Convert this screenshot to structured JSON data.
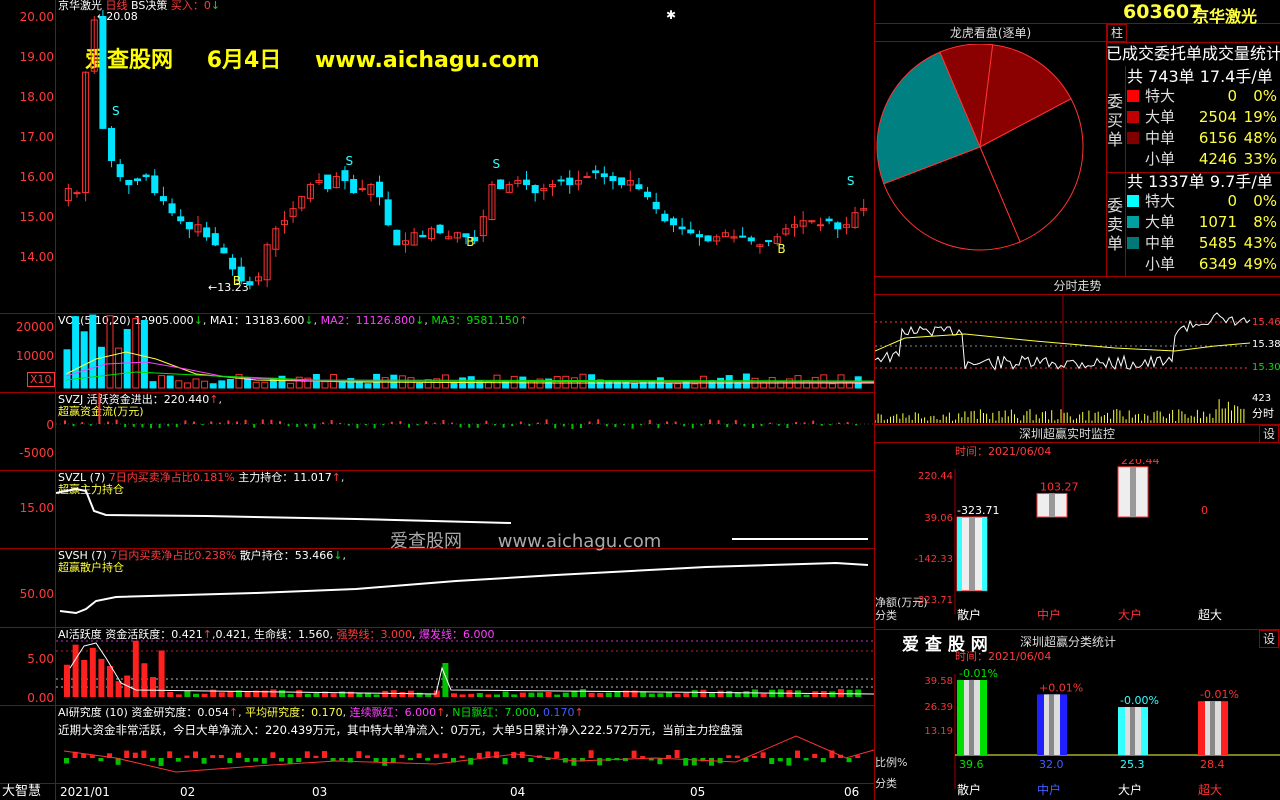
{
  "app": {
    "name": "大智慧"
  },
  "main": {
    "chart_label": "京华激光",
    "period": "日线",
    "strategy": "BS决策",
    "buy_label": "买入：",
    "buy_value": "0",
    "watermark_title": "爱查股网",
    "watermark_date": "6月4日",
    "watermark_url": "www.aichagu.com",
    "high_label": "20.08",
    "low_label": "13.23",
    "price_axis": [
      "20.00",
      "19.00",
      "18.00",
      "17.00",
      "16.00",
      "15.00",
      "14.00"
    ],
    "signals": {
      "buy": "B",
      "sell": "S"
    }
  },
  "chart_data": [
    {
      "type": "candlestick",
      "title": "京华激光 日线",
      "ylim": [
        13.0,
        20.2
      ],
      "high": 20.08,
      "low": 13.23,
      "ohlc_closes": [
        15.8,
        15.7,
        18.7,
        20.0,
        17.3,
        16.5,
        16.1,
        15.9,
        16.0,
        16.1,
        15.7,
        15.5,
        15.2,
        15.0,
        14.8,
        14.9,
        14.6,
        14.4,
        14.2,
        13.8,
        13.5,
        13.4,
        13.6,
        14.4,
        14.8,
        15.0,
        15.3,
        15.6,
        15.9,
        16.0,
        15.8,
        16.1,
        16.0,
        15.7,
        15.8,
        15.9,
        15.6,
        14.9,
        14.4,
        14.5,
        14.7,
        14.6,
        14.8,
        14.7,
        14.6,
        14.7,
        14.6,
        14.5,
        15.1,
        15.9,
        15.8,
        15.9,
        16.0,
        15.9,
        15.7,
        15.8,
        15.9,
        16.0,
        15.9,
        16.0,
        16.1,
        16.2,
        16.1,
        16.0,
        15.9,
        16.0,
        15.8,
        15.6,
        15.3,
        15.0,
        14.9,
        14.8,
        14.7,
        14.6,
        14.5,
        14.6,
        14.7,
        14.6,
        14.6,
        14.5,
        14.4,
        14.5,
        14.6,
        14.8,
        14.9,
        15.0,
        15.0,
        14.9,
        15.0,
        14.8,
        14.9,
        15.2,
        15.3
      ],
      "sell_signals": 4,
      "buy_signals": 4
    },
    {
      "type": "bar",
      "title": "VOL(5,10,20)",
      "values_label": "12905.000",
      "ma1_label": "MA1：",
      "ma1": "13183.600",
      "ma2_label": "MA2：",
      "ma2": "11126.800",
      "ma3_label": "MA3：",
      "ma3": "9581.150",
      "ticks": [
        "20000",
        "10000"
      ],
      "unit": "X10"
    },
    {
      "type": "bar",
      "title": "SVZJ",
      "line1": "活跃资金进出：",
      "v1": "220.440",
      "line2": "超赢资金流(万元)",
      "ticks": [
        "0",
        "-5000"
      ]
    },
    {
      "type": "line",
      "title": "SVZL (7)",
      "t1": "7日内买卖净占比",
      "v1": "0.181%",
      "t2": "主力持仓：",
      "v2": "11.017",
      "sub": "超赢主力持仓",
      "ticks": [
        "15.00"
      ]
    },
    {
      "type": "line",
      "title": "SVSH (7)",
      "t1": "7日内买卖净占比",
      "v1": "0.238%",
      "t2": "散户持仓：",
      "v2": "53.466",
      "sub": "超赢散户持仓",
      "ticks": [
        "50.00"
      ]
    },
    {
      "type": "bar",
      "title": "AI活跃度",
      "t1": "资金活跃度：",
      "v1": "0.421",
      "v1b": "0.421",
      "t2": "生命线：",
      "v2": "1.560",
      "t3": "强势线：",
      "v3": "3.000",
      "t4": "爆发线：",
      "v4": "6.000",
      "ticks": [
        "5.00",
        "0.00"
      ]
    },
    {
      "type": "bar",
      "title": "AI研究度 (10)",
      "t1": "资金研究度：",
      "v1": "0.054",
      "t2": "平均研究度：",
      "v2": "0.170",
      "t3": "连续飘红：",
      "v3": "6.000",
      "t4": "N日飘红：",
      "v4": "7.000",
      "v5": "0.170",
      "summary": "近期大资金非常活跃，今日大单净流入：220.439万元，其中特大单净流入：0万元，大单5日累计净入222.572万元，当前主力控盘强"
    },
    {
      "type": "pie",
      "title": "龙虎看盘(逐单)",
      "slices": [
        {
          "name": "特大(买)",
          "value": 0
        },
        {
          "name": "大单(买)",
          "value": 19
        },
        {
          "name": "中单(买)",
          "value": 48
        },
        {
          "name": "小单(买)",
          "value": 33
        }
      ]
    },
    {
      "type": "line",
      "title": "分时走势",
      "ticks": [
        "15.46",
        "15.38",
        "15.30",
        "423"
      ],
      "vol_label": "分时"
    },
    {
      "type": "bar",
      "title": "深圳超赢实时监控",
      "date_label": "时间：",
      "date": "2021/06/04",
      "categories": [
        "散户",
        "中户",
        "大户",
        "超大"
      ],
      "values": [
        -323.71,
        103.27,
        220.44,
        0
      ],
      "ylabels": [
        "220.44",
        "39.06",
        "-142.33",
        "-323.71"
      ],
      "ylabel": "净额(万元)",
      "xlabel": "分类"
    },
    {
      "type": "bar",
      "title": "深圳超赢分类统计",
      "date_label": "时间：",
      "date": "2021/06/04",
      "categories": [
        "散户",
        "中户",
        "大户",
        "超大"
      ],
      "values": [
        39.6,
        32.0,
        25.3,
        28.4
      ],
      "changes": [
        "-0.01%",
        "+0.01%",
        "-0.00%",
        "-0.01%"
      ],
      "ylabels": [
        "39.58",
        "26.39",
        "13.19"
      ],
      "ylabel": "比例%",
      "xlabel": "分类"
    }
  ],
  "time_axis": [
    "2021/01",
    "02",
    "03",
    "04",
    "05",
    "06"
  ],
  "right": {
    "code": "603607",
    "name": "京华激光",
    "btn_zhu": "柱",
    "pie_title": "龙虎看盘(逐单)",
    "stat_title": "已成交委托单成交量统计",
    "buy": {
      "side": "委买单",
      "total": "共 743单 17.4手/单",
      "rows": [
        {
          "name": "特大",
          "vol": "0",
          "pct": "0%",
          "color": "#ff0000"
        },
        {
          "name": "大单",
          "vol": "2504",
          "pct": "19%",
          "color": "#c00000"
        },
        {
          "name": "中单",
          "vol": "6156",
          "pct": "48%",
          "color": "#800000"
        },
        {
          "name": "小单",
          "vol": "4246",
          "pct": "33%",
          "color": "#000000"
        }
      ]
    },
    "sell": {
      "side": "委卖单",
      "total": "共 1337单 9.7手/单",
      "rows": [
        {
          "name": "特大",
          "vol": "0",
          "pct": "0%",
          "color": "#00ffff"
        },
        {
          "name": "大单",
          "vol": "1071",
          "pct": "8%",
          "color": "#00a0a0"
        },
        {
          "name": "中单",
          "vol": "5485",
          "pct": "43%",
          "color": "#007878"
        },
        {
          "name": "小单",
          "vol": "6349",
          "pct": "49%",
          "color": "#000000"
        }
      ]
    },
    "intraday_title": "分时走势",
    "monitor_title": "深圳超赢实时监控",
    "set_label": "设",
    "logo": "爱 查 股 网",
    "stat2_title": "深圳超赢分类统计"
  }
}
